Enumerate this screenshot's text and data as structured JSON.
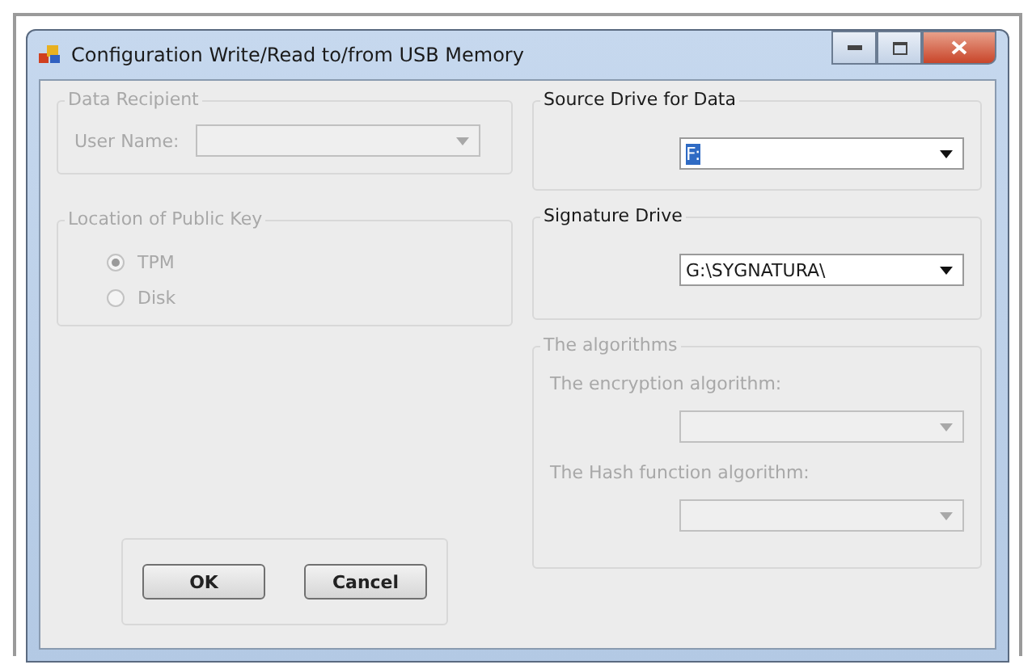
{
  "window": {
    "title": "Configuration Write/Read to/from USB Memory"
  },
  "data_recipient": {
    "title": "Data Recipient",
    "disabled": true,
    "user_name": {
      "label": "User Name:",
      "disabled": true
    }
  },
  "public_key": {
    "title": "Location of Public Key",
    "disabled": true,
    "options": [
      {
        "label": "TPM",
        "selected": true
      },
      {
        "label": "Disk",
        "selected": false
      }
    ]
  },
  "buttons": [
    {
      "label": "OK"
    },
    {
      "label": "Cancel"
    }
  ],
  "source_drive": {
    "title": "Source Drive for Data",
    "disabled": false,
    "combo": {
      "value": "F:",
      "highlighted": true,
      "disabled": false
    }
  },
  "signature_drive": {
    "title": "Signature Drive",
    "disabled": false,
    "combo": {
      "value": "G:\\SYGNATURA\\",
      "highlighted": false,
      "disabled": false
    }
  },
  "algorithms": {
    "title": "The algorithms",
    "disabled": true,
    "fields": [
      {
        "label": "The encryption algorithm:",
        "disabled": true
      },
      {
        "label": "The Hash function algorithm:",
        "disabled": true
      }
    ]
  }
}
